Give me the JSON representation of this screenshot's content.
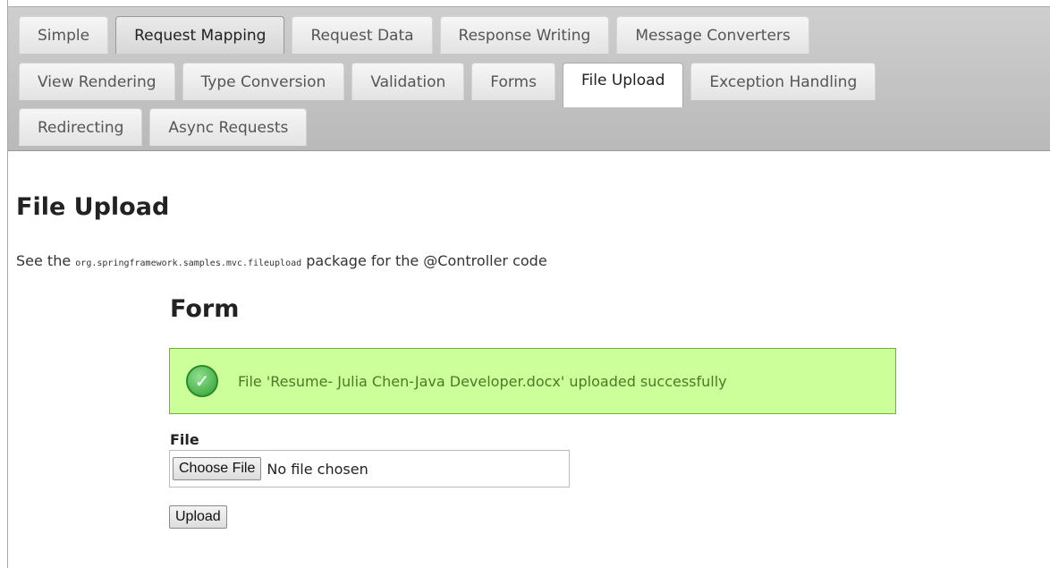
{
  "tabs": {
    "row1": [
      "Simple",
      "Request Mapping",
      "Request Data",
      "Response Writing",
      "Message Converters"
    ],
    "row2": [
      "View Rendering",
      "Type Conversion",
      "Validation",
      "Forms",
      "File Upload",
      "Exception Handling"
    ],
    "row3": [
      "Redirecting",
      "Async Requests"
    ],
    "active": "File Upload",
    "hovered": "Request Mapping"
  },
  "page": {
    "title": "File Upload",
    "intro_prefix": "See the ",
    "intro_code": "org.springframework.samples.mvc.fileupload",
    "intro_suffix": " package for the @Controller code"
  },
  "form": {
    "title": "Form",
    "success_message": "File 'Resume- Julia Chen-Java Developer.docx' uploaded successfully",
    "success_icon": "checkmark-circle-icon",
    "file_label": "File",
    "choose_button": "Choose File",
    "file_status": "No file chosen",
    "upload_button": "Upload"
  },
  "colors": {
    "success_bg": "#ccff99",
    "success_border": "#66bb33",
    "success_text": "#4a7a25",
    "tabbar_bg": "#c4c4c4"
  }
}
